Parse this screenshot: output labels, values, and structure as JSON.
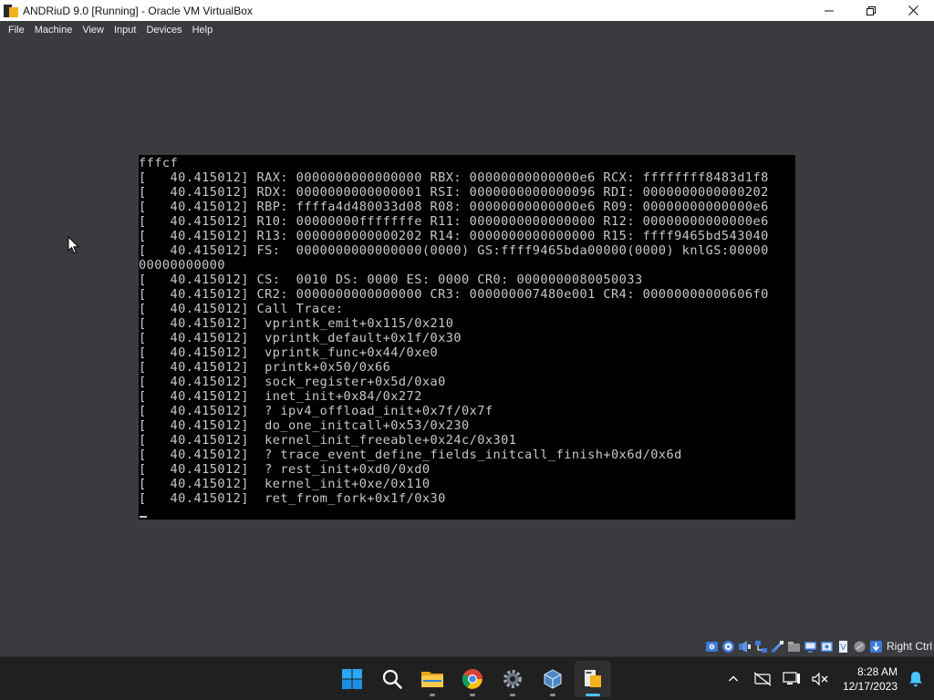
{
  "window": {
    "title": "ANDRiuD 9.0 [Running] - Oracle VM VirtualBox",
    "app_icon": "virtualbox-icon",
    "controls": [
      "minimize-icon",
      "maximize-icon",
      "close-icon"
    ]
  },
  "menu": {
    "items": [
      "File",
      "Machine",
      "View",
      "Input",
      "Devices",
      "Help"
    ]
  },
  "console": {
    "lines": [
      "fffcf",
      "[   40.415012] RAX: 0000000000000000 RBX: 00000000000000e6 RCX: ffffffff8483d1f8",
      "[   40.415012] RDX: 0000000000000001 RSI: 0000000000000096 RDI: 0000000000000202",
      "[   40.415012] RBP: ffffa4d480033d08 R08: 00000000000000e6 R09: 00000000000000e6",
      "[   40.415012] R10: 00000000fffffffe R11: 0000000000000000 R12: 00000000000000e6",
      "[   40.415012] R13: 0000000000000202 R14: 0000000000000000 R15: ffff9465bd543040",
      "[   40.415012] FS:  0000000000000000(0000) GS:ffff9465bda00000(0000) knlGS:00000",
      "00000000000",
      "[   40.415012] CS:  0010 DS: 0000 ES: 0000 CR0: 0000000080050033",
      "[   40.415012] CR2: 0000000000000000 CR3: 000000007480e001 CR4: 00000000000606f0",
      "[   40.415012] Call Trace:",
      "[   40.415012]  vprintk_emit+0x115/0x210",
      "[   40.415012]  vprintk_default+0x1f/0x30",
      "[   40.415012]  vprintk_func+0x44/0xe0",
      "[   40.415012]  printk+0x50/0x66",
      "[   40.415012]  sock_register+0x5d/0xa0",
      "[   40.415012]  inet_init+0x84/0x272",
      "[   40.415012]  ? ipv4_offload_init+0x7f/0x7f",
      "[   40.415012]  do_one_initcall+0x53/0x230",
      "[   40.415012]  kernel_init_freeable+0x24c/0x301",
      "[   40.415012]  ? trace_event_define_fields_initcall_finish+0x6d/0x6d",
      "[   40.415012]  ? rest_init+0xd0/0xd0",
      "[   40.415012]  kernel_init+0xe/0x110",
      "[   40.415012]  ret_from_fork+0x1f/0x30"
    ]
  },
  "statusbar": {
    "icons": [
      "hard-disk-icon",
      "optical-drive-icon",
      "audio-icon",
      "network-icon",
      "usb-icon",
      "shared-folders-icon",
      "display-icon",
      "recording-icon",
      "cpu-icon",
      "mouse-integration-icon",
      "arrow-down-icon"
    ],
    "host_key": "Right Ctrl"
  },
  "taskbar": {
    "apps": [
      "windows-start-icon",
      "search-icon",
      "file-explorer-icon",
      "chrome-icon",
      "settings-icon",
      "virtualbox-manager-icon",
      "virtualbox-vm-icon"
    ],
    "tray": [
      "chevron-up-icon",
      "network-disconnected-icon",
      "display-icon",
      "volume-muted-icon",
      "notification-bell-icon"
    ],
    "time": "8:28 AM",
    "date": "12/17/2023"
  },
  "colors": {
    "vm_background": "#3a3b3f",
    "console_background": "#000000",
    "console_text": "#c8c8c8",
    "taskbar_background": "#202020",
    "accent": "#4cc2ff"
  }
}
